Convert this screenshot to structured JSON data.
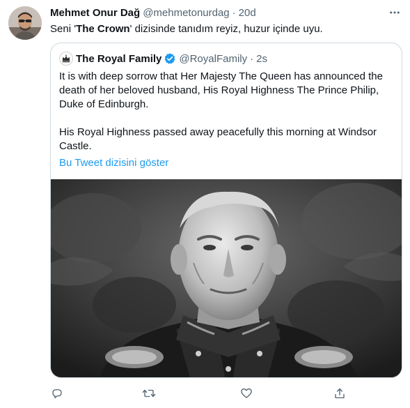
{
  "tweet": {
    "author_name": "Mehmet Onur Dağ",
    "author_handle": "@mehmetonurdag",
    "separator": "·",
    "time": "20d",
    "text_prefix": "Seni '",
    "text_bold": "The Crown",
    "text_suffix": "' dizisinde tanıdım reyiz, huzur içinde uyu."
  },
  "quoted": {
    "author_name": "The Royal Family",
    "author_handle": "@RoyalFamily",
    "separator": "·",
    "time": "2s",
    "paragraph_1": "It is with deep sorrow that Her Majesty The Queen has announced the death of her beloved husband, His Royal Highness The Prince Philip, Duke of Edinburgh.",
    "paragraph_2": "His Royal Highness passed away peacefully this morning at Windsor Castle.",
    "thread_link": "Bu Tweet dizisini göster"
  },
  "icons": {
    "more": "more-icon",
    "verified": "verified-badge-icon",
    "reply": "reply-icon",
    "retweet": "retweet-icon",
    "like": "like-icon",
    "share": "share-icon"
  },
  "colors": {
    "accent": "#1d9bf0",
    "text_primary": "#0f1419",
    "text_secondary": "#536471",
    "border": "#cfd9de"
  }
}
